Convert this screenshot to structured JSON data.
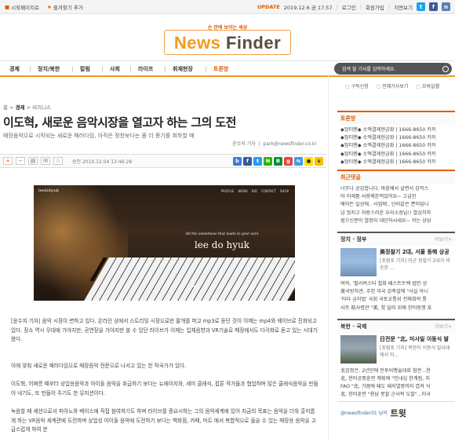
{
  "topbar": {
    "homepage_label": "시작페이지로",
    "favorites_label": "즐겨찾기 추가",
    "update_label": "UPDATE",
    "datetime": "2019.12.6 금 17:57",
    "login": "로그인",
    "signup": "회원가입",
    "branch": "지면보기"
  },
  "logo": {
    "tagline": "손 안에 보이는 세상",
    "word1": "News",
    "word2": "Finder"
  },
  "nav": {
    "items": [
      "경제",
      "정치/북한",
      "칼럼",
      "사회",
      "라이프",
      "취재현장",
      "토론방"
    ],
    "search_placeholder": "검색 할 기사를 입력하세요."
  },
  "utility": {
    "items": [
      "구독신청",
      "전체기사보기",
      "모바일웹"
    ]
  },
  "article": {
    "breadcrumb_home": "홈",
    "breadcrumb_1": "경제",
    "breadcrumb_2": "비지니스",
    "title": "이도혁, 새로운 음악시장을 열고자 하는 그의 도전",
    "subtitle": "매장음악으로 시작되는 새로운 패러다임, 아직은 정찬보다는 좀 더 풍기를 취하할 때",
    "reporter": "윤수지 기자",
    "email": "park@newsfinder.co.kr",
    "published": "승인 2019.12.04  13:46:28",
    "photo": {
      "brand": "leedohyuk",
      "nav": [
        "PROFILE",
        "WORK",
        "BIO",
        "CONTACT",
        "SHOP"
      ],
      "tagline": "All the sweetness that leads to your ears",
      "name": "lee do hyuk"
    },
    "paragraphs": [
      "[윤수지 기자] 음악 시장이 변하고 있다. 온라인 상에서 스트리밍 시장으로만 팔개를 퍼고 mp3로 듣던 것이 이제는 mp4와 웨이브로 진화되고 있다. 장소 역시 무대에 가야지만, 공연장을 가야지만 볼 수 있던 라이브가 이제는 입체음향과 VR기술로 매장에서도 다각화로 듣고 있는 시대가 왔다.",
      "이에 맞춰 새로운 패러다임으로 매장음악 전문으로 나서고 있는 한 작곡가가 있다.",
      "이도혁, 어쩌릉 때부터 상업용음악과 아이돌 음악을 취급하기 보다는 뉴에이지와, 세미 클래식, 팝론 작가들과 협업하며 많은 클래식음악을 만들어 내기도, 또 만들어 주기도 한 뮤지션이다.",
      "녹음할 때 세션으로서 피아노와 베이스에 직접 참여하기도 하며 라이브를 중요시하는 그의 음악세계에 있어 지금의 목표는 음악을 더욱 흥미롭게 하는 VR음악 세계관에 도전하며 상업성 아이돌 음악에 도전하기 보다는 백화점, 카페, 마트 에서 복합적으로 들을 수 있는 매장용 음악을 고급스럽게 하여 분"
    ]
  },
  "sidebar": {
    "discussion_title": "토론방",
    "discussion_items": [
      "◆엄티멘◆ 소액결제현금화 | 1666-8650 카카",
      "◆엄티멘◆ 소액결제현금화 | 1666-8650 카카",
      "◆엄티멘◆ 소액결제현금화 | 1666-8650 카카",
      "◆엄티멘◆ 소액결제현금화 | 1666-8650 카카",
      "◆엄티멘◆ 소액결제현금화 | 1666-8650 카카"
    ],
    "comments_title": "최근댓글",
    "comments_items": [
      "너무나 공감합니다. 마음에서 살면서 감작스",
      "아 이제품 사용해본적있어요~ 고급진",
      "메이든 일상에.. 사업에.. 단비같은 뿐이답니",
      "넘 멋지고 자랑스러운 우리소장님!! 열심히하",
      "점으신분이 열정이 대단하시네요~ 저는 상당"
    ],
    "politics_title": "정치 · 정부",
    "politics_more": "더보기+",
    "politics_card": {
      "title": "美정찰기 2대, 서울 동해 상공",
      "desc": "[포럼포 기자] 미군 정찰기 2대가 비슷한 ..."
    },
    "politics_items": [
      "여야, '필리버스터 철회·패스트트랙 법안 상",
      "美국방차관, 주한 미국 감축설에 \"사실 아니",
      "'타다 금지법' 국회 국토교통위 전체회의 통",
      "샤프 前사령관 \"美, 첫 달러 위해 한미동맹 포"
    ],
    "nk_title": "북한 · 국제",
    "nk_more": "더보기+",
    "nk_card": {
      "title": "日전문 \"北, 미사일 이동식 발",
      "desc": "[포럼포 기자] 북한이 이동식 발사대에서 미..."
    },
    "nk_items": [
      "北김정은, 2년만에 전투비행술대회 참관...한",
      "北, 한미공중훈련 계획에 \"인내심 한계점, 지",
      "FAO \"北, 가뭄에 돼도 돼지열병까지 겹쳐 식",
      "北, 한미훈련 \"용납 못할 군사적 도발\"...미국"
    ],
    "twitter_handle": "@newsfinder01 님의",
    "twitter_label": "트윗"
  },
  "colors": {
    "accent": "#e05a00",
    "logo_orange": "#f29a1f",
    "logo_brown": "#5b4b3a",
    "facebook": "#3b5998",
    "twitter": "#1da1f2"
  }
}
